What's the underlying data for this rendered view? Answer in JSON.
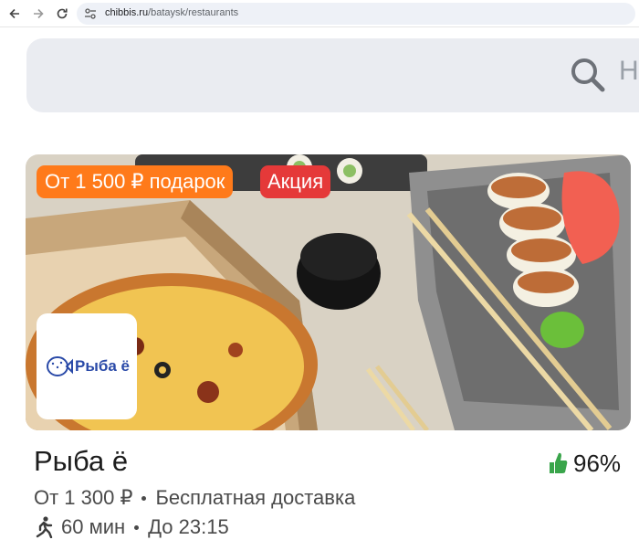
{
  "browser": {
    "url_host": "chibbis.ru",
    "url_path": "/bataysk/restaurants"
  },
  "search": {
    "placeholder_visible": "Н"
  },
  "card": {
    "badge_gift": "От 1 500 ₽ подарок",
    "badge_promo": "Акция",
    "logo_text": "Рыба ё",
    "name": "Рыба ё",
    "rating": "96%",
    "min_order": "От 1 300 ₽",
    "delivery": "Бесплатная доставка",
    "time": "60 мин",
    "until": "До 23:15"
  },
  "colors": {
    "badge_gift": "#ff7a1a",
    "badge_promo": "#e53939",
    "rating_thumb": "#3aa54b",
    "logo_brand": "#2a4aa8"
  }
}
